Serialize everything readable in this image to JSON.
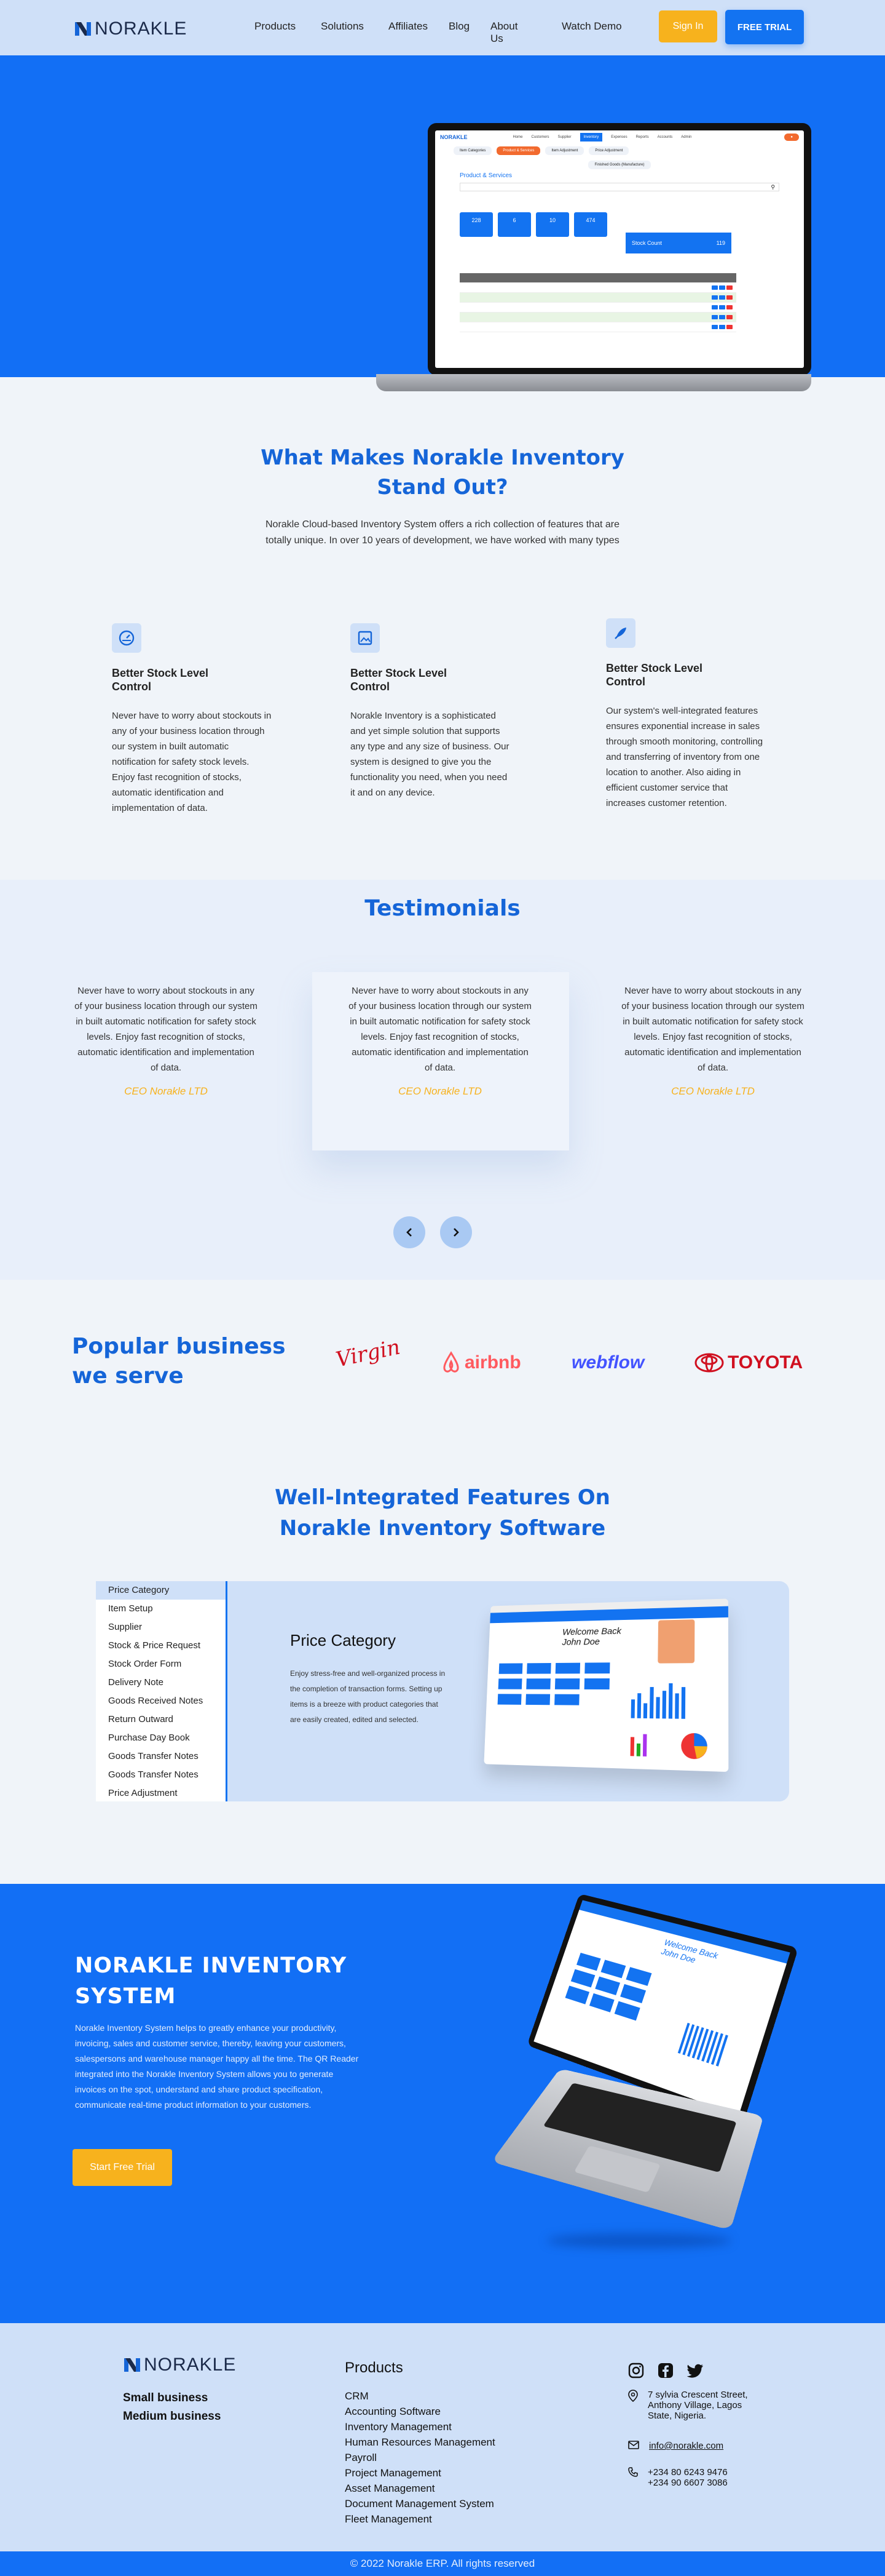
{
  "brand": {
    "logo_text": "NORAKLE"
  },
  "nav": {
    "links": [
      "Products",
      "Solutions",
      "Affiliates",
      "Blog",
      "About Us",
      "Watch Demo"
    ],
    "sign_in": "Sign In",
    "free_trial": "FREE TRIAL"
  },
  "hero_mock": {
    "top_menu": [
      "Home",
      "Customers",
      "Supplier",
      "Inventory",
      "Expenses",
      "Reports",
      "Accounts",
      "Admin"
    ],
    "tabs": [
      "Item Categories",
      "Product & Services",
      "Item Adjustment",
      "Price Adjustment"
    ],
    "tab_sub": "Finished Goods (Manufacture)",
    "title": "Product & Services",
    "stats": [
      "228",
      "6",
      "10",
      "474"
    ],
    "stock_label": "Stock Count",
    "stock_value": "119",
    "colors": {
      "accent": "#1373f1",
      "orange": "#f26a2e"
    }
  },
  "stand_out": {
    "title": "What Makes Norakle Inventory Stand Out?",
    "intro": "Norakle Cloud-based Inventory System offers a rich collection of features that are totally unique. In over 10 years of development, we have worked with many types",
    "features": [
      {
        "icon": "speedometer-icon",
        "title": "Better Stock Level Control",
        "text": "Never have to worry about stockouts in any of your business location through our system in built automatic notification for safety stock levels. Enjoy fast recognition of stocks, automatic identification and implementation of data."
      },
      {
        "icon": "image-icon",
        "title": "Better Stock Level Control",
        "text": "Norakle Inventory is a sophisticated and yet simple solution that supports any type and any size of business. Our system is designed to give you the functionality you need, when you need it and on any device."
      },
      {
        "icon": "rocket-icon",
        "title": "Better Stock Level Control",
        "text": "Our system's well-integrated features ensures exponential increase in sales through smooth monitoring, controlling and transferring of inventory from one location to another. Also aiding in efficient customer service that increases customer retention."
      }
    ]
  },
  "testimonials": {
    "title": "Testimonials",
    "items": [
      {
        "text": "Never have to worry about stockouts in any of your business location through our system in built automatic notification for safety stock levels. Enjoy fast recognition of stocks, automatic identification and implementation of data.",
        "who": "CEO Norakle LTD"
      },
      {
        "text": "Never have to worry about stockouts in any of your business location through our system in built automatic notification for safety stock levels. Enjoy fast recognition of stocks, automatic identification and implementation of data.",
        "who": "CEO Norakle LTD"
      },
      {
        "text": "Never have to worry about stockouts in any of your business location through our system in built automatic notification for safety stock levels. Enjoy fast recognition of stocks, automatic identification and implementation of data.",
        "who": "CEO Norakle LTD"
      }
    ]
  },
  "popular": {
    "title_line1": "Popular business",
    "title_line2": "we serve",
    "brands": [
      "Virgin",
      "airbnb",
      "webflow",
      "TOYOTA"
    ]
  },
  "integrated": {
    "title": "Well-Integrated Features On Norakle Inventory Software",
    "menu": [
      "Price Category",
      "Item Setup",
      "Supplier",
      "Stock & Price Request",
      "Stock Order Form",
      "Delivery Note",
      "Goods Received Notes",
      "Return Outward",
      "Purchase Day Book",
      "Goods Transfer Notes",
      "Goods Transfer Notes",
      "Price Adjustment"
    ],
    "active_index": 0,
    "detail_title": "Price Category",
    "detail_text": "Enjoy stress-free and well-organized process in the completion of transaction forms. Setting up items is a breeze with product categories that are easily created, edited and selected.",
    "mock_welcome": "Welcome Back John Doe"
  },
  "cta": {
    "title_line1": "NORAKLE INVENTORY",
    "title_line2": "SYSTEM",
    "text": "Norakle Inventory System helps to greatly enhance your productivity, invoicing, sales and customer service, thereby, leaving your customers, salespersons and warehouse manager happy all the time. The QR Reader integrated into the Norakle Inventory System allows you to generate invoices on the spot, understand and share product specification, communicate real-time product information to your customers.",
    "button": "Start Free Trial",
    "mock_welcome": "Welcome Back John Doe"
  },
  "footer": {
    "small_business": "Small business",
    "medium_business": "Medium business",
    "products_title": "Products",
    "products": [
      "CRM",
      "Accounting Software",
      "Inventory Management",
      "Human Resources Management",
      "Payroll",
      "Project Management",
      "Asset Management",
      "Document Management System",
      "Fleet Management"
    ],
    "social": [
      "instagram-icon",
      "facebook-icon",
      "twitter-icon"
    ],
    "address": "7 sylvia Crescent Street, Anthony Village, Lagos State, Nigeria.",
    "email": "info@norakle.com",
    "phone1": "+234 80 6243 9476",
    "phone2": "+234 90 6607 3086",
    "copyright": "© 2022 Norakle ERP. All rights reserved"
  }
}
